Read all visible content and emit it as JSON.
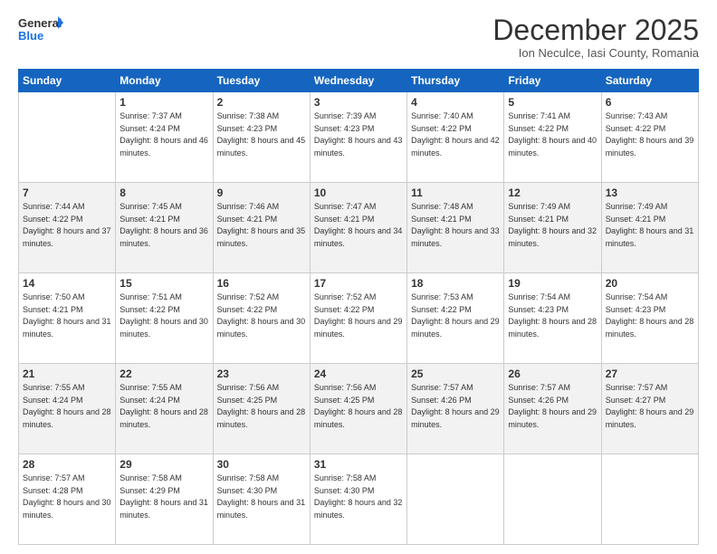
{
  "logo": {
    "line1": "General",
    "line2": "Blue"
  },
  "title": "December 2025",
  "subtitle": "Ion Neculce, Iasi County, Romania",
  "days_of_week": [
    "Sunday",
    "Monday",
    "Tuesday",
    "Wednesday",
    "Thursday",
    "Friday",
    "Saturday"
  ],
  "weeks": [
    {
      "row_style": "normal-row",
      "days": [
        {
          "number": "",
          "sunrise": "",
          "sunset": "",
          "daylight": ""
        },
        {
          "number": "1",
          "sunrise": "Sunrise: 7:37 AM",
          "sunset": "Sunset: 4:24 PM",
          "daylight": "Daylight: 8 hours and 46 minutes."
        },
        {
          "number": "2",
          "sunrise": "Sunrise: 7:38 AM",
          "sunset": "Sunset: 4:23 PM",
          "daylight": "Daylight: 8 hours and 45 minutes."
        },
        {
          "number": "3",
          "sunrise": "Sunrise: 7:39 AM",
          "sunset": "Sunset: 4:23 PM",
          "daylight": "Daylight: 8 hours and 43 minutes."
        },
        {
          "number": "4",
          "sunrise": "Sunrise: 7:40 AM",
          "sunset": "Sunset: 4:22 PM",
          "daylight": "Daylight: 8 hours and 42 minutes."
        },
        {
          "number": "5",
          "sunrise": "Sunrise: 7:41 AM",
          "sunset": "Sunset: 4:22 PM",
          "daylight": "Daylight: 8 hours and 40 minutes."
        },
        {
          "number": "6",
          "sunrise": "Sunrise: 7:43 AM",
          "sunset": "Sunset: 4:22 PM",
          "daylight": "Daylight: 8 hours and 39 minutes."
        }
      ]
    },
    {
      "row_style": "alt-row",
      "days": [
        {
          "number": "7",
          "sunrise": "Sunrise: 7:44 AM",
          "sunset": "Sunset: 4:22 PM",
          "daylight": "Daylight: 8 hours and 37 minutes."
        },
        {
          "number": "8",
          "sunrise": "Sunrise: 7:45 AM",
          "sunset": "Sunset: 4:21 PM",
          "daylight": "Daylight: 8 hours and 36 minutes."
        },
        {
          "number": "9",
          "sunrise": "Sunrise: 7:46 AM",
          "sunset": "Sunset: 4:21 PM",
          "daylight": "Daylight: 8 hours and 35 minutes."
        },
        {
          "number": "10",
          "sunrise": "Sunrise: 7:47 AM",
          "sunset": "Sunset: 4:21 PM",
          "daylight": "Daylight: 8 hours and 34 minutes."
        },
        {
          "number": "11",
          "sunrise": "Sunrise: 7:48 AM",
          "sunset": "Sunset: 4:21 PM",
          "daylight": "Daylight: 8 hours and 33 minutes."
        },
        {
          "number": "12",
          "sunrise": "Sunrise: 7:49 AM",
          "sunset": "Sunset: 4:21 PM",
          "daylight": "Daylight: 8 hours and 32 minutes."
        },
        {
          "number": "13",
          "sunrise": "Sunrise: 7:49 AM",
          "sunset": "Sunset: 4:21 PM",
          "daylight": "Daylight: 8 hours and 31 minutes."
        }
      ]
    },
    {
      "row_style": "normal-row",
      "days": [
        {
          "number": "14",
          "sunrise": "Sunrise: 7:50 AM",
          "sunset": "Sunset: 4:21 PM",
          "daylight": "Daylight: 8 hours and 31 minutes."
        },
        {
          "number": "15",
          "sunrise": "Sunrise: 7:51 AM",
          "sunset": "Sunset: 4:22 PM",
          "daylight": "Daylight: 8 hours and 30 minutes."
        },
        {
          "number": "16",
          "sunrise": "Sunrise: 7:52 AM",
          "sunset": "Sunset: 4:22 PM",
          "daylight": "Daylight: 8 hours and 30 minutes."
        },
        {
          "number": "17",
          "sunrise": "Sunrise: 7:52 AM",
          "sunset": "Sunset: 4:22 PM",
          "daylight": "Daylight: 8 hours and 29 minutes."
        },
        {
          "number": "18",
          "sunrise": "Sunrise: 7:53 AM",
          "sunset": "Sunset: 4:22 PM",
          "daylight": "Daylight: 8 hours and 29 minutes."
        },
        {
          "number": "19",
          "sunrise": "Sunrise: 7:54 AM",
          "sunset": "Sunset: 4:23 PM",
          "daylight": "Daylight: 8 hours and 28 minutes."
        },
        {
          "number": "20",
          "sunrise": "Sunrise: 7:54 AM",
          "sunset": "Sunset: 4:23 PM",
          "daylight": "Daylight: 8 hours and 28 minutes."
        }
      ]
    },
    {
      "row_style": "alt-row",
      "days": [
        {
          "number": "21",
          "sunrise": "Sunrise: 7:55 AM",
          "sunset": "Sunset: 4:24 PM",
          "daylight": "Daylight: 8 hours and 28 minutes."
        },
        {
          "number": "22",
          "sunrise": "Sunrise: 7:55 AM",
          "sunset": "Sunset: 4:24 PM",
          "daylight": "Daylight: 8 hours and 28 minutes."
        },
        {
          "number": "23",
          "sunrise": "Sunrise: 7:56 AM",
          "sunset": "Sunset: 4:25 PM",
          "daylight": "Daylight: 8 hours and 28 minutes."
        },
        {
          "number": "24",
          "sunrise": "Sunrise: 7:56 AM",
          "sunset": "Sunset: 4:25 PM",
          "daylight": "Daylight: 8 hours and 28 minutes."
        },
        {
          "number": "25",
          "sunrise": "Sunrise: 7:57 AM",
          "sunset": "Sunset: 4:26 PM",
          "daylight": "Daylight: 8 hours and 29 minutes."
        },
        {
          "number": "26",
          "sunrise": "Sunrise: 7:57 AM",
          "sunset": "Sunset: 4:26 PM",
          "daylight": "Daylight: 8 hours and 29 minutes."
        },
        {
          "number": "27",
          "sunrise": "Sunrise: 7:57 AM",
          "sunset": "Sunset: 4:27 PM",
          "daylight": "Daylight: 8 hours and 29 minutes."
        }
      ]
    },
    {
      "row_style": "normal-row",
      "days": [
        {
          "number": "28",
          "sunrise": "Sunrise: 7:57 AM",
          "sunset": "Sunset: 4:28 PM",
          "daylight": "Daylight: 8 hours and 30 minutes."
        },
        {
          "number": "29",
          "sunrise": "Sunrise: 7:58 AM",
          "sunset": "Sunset: 4:29 PM",
          "daylight": "Daylight: 8 hours and 31 minutes."
        },
        {
          "number": "30",
          "sunrise": "Sunrise: 7:58 AM",
          "sunset": "Sunset: 4:30 PM",
          "daylight": "Daylight: 8 hours and 31 minutes."
        },
        {
          "number": "31",
          "sunrise": "Sunrise: 7:58 AM",
          "sunset": "Sunset: 4:30 PM",
          "daylight": "Daylight: 8 hours and 32 minutes."
        },
        {
          "number": "",
          "sunrise": "",
          "sunset": "",
          "daylight": ""
        },
        {
          "number": "",
          "sunrise": "",
          "sunset": "",
          "daylight": ""
        },
        {
          "number": "",
          "sunrise": "",
          "sunset": "",
          "daylight": ""
        }
      ]
    }
  ]
}
